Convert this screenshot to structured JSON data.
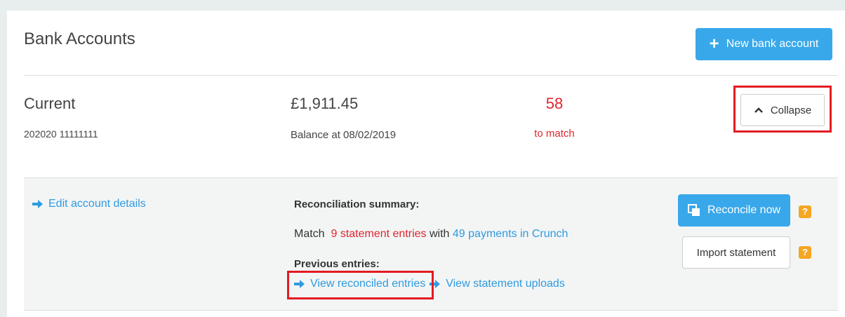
{
  "header": {
    "title": "Bank Accounts",
    "new_button_label": "New bank account"
  },
  "account": {
    "name": "Current",
    "number": "202020 11111111",
    "balance": "£1,911.45",
    "balance_label": "Balance at 08/02/2019",
    "match_count": "58",
    "match_label": "to match",
    "collapse_label": "Collapse"
  },
  "panel": {
    "edit_link": "Edit account details",
    "recon_title": "Reconciliation summary:",
    "match_prefix": "Match",
    "statement_entries": "9 statement entries",
    "match_with": "with",
    "payments": "49 payments in Crunch",
    "previous_title": "Previous entries:",
    "view_reconciled": "View reconciled entries",
    "view_uploads": "View statement uploads",
    "reconcile_button": "Reconcile now",
    "import_button": "Import statement",
    "help_glyph": "?"
  },
  "colors": {
    "accent": "#38a8ea",
    "link": "#2e9be0",
    "alert": "#e0262e",
    "highlight": "#e31b23",
    "help": "#f5a623"
  },
  "icons": [
    "plus-icon",
    "chevron-up-icon",
    "arrow-right-icon",
    "reconcile-icon",
    "help-icon"
  ]
}
